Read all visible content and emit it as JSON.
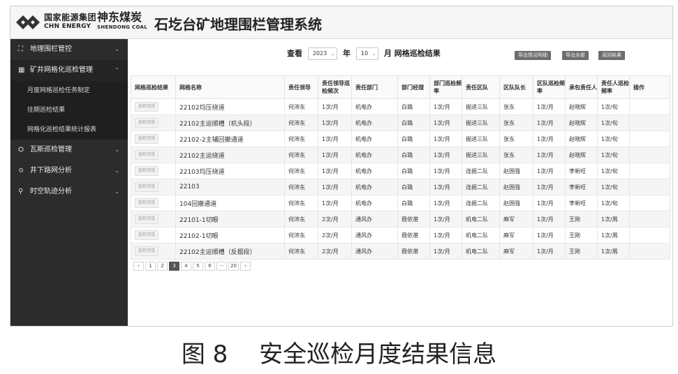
{
  "header": {
    "brand1_cn": "国家能源集团",
    "brand1_en": "CHN ENERGY",
    "brand2_cn": "神东煤炭",
    "brand2_en": "SHENDONG COAL",
    "system_title": "石圪台矿地理围栏管理系统",
    "logo_icon": "chn-energy-logo-icon"
  },
  "sidebar": {
    "items": [
      {
        "label": "地理围栏管控",
        "icon": "geofence-icon",
        "glyph": "⛶",
        "chevron": "⌄"
      },
      {
        "label": "矿井网格化巡检管理",
        "icon": "grid-icon",
        "glyph": "▦",
        "chevron": "⌃"
      },
      {
        "label": "瓦斯巡检管理",
        "icon": "gas-icon",
        "glyph": "⛭",
        "chevron": "⌄"
      },
      {
        "label": "井下路网分析",
        "icon": "network-icon",
        "glyph": "≎",
        "chevron": "⌄"
      },
      {
        "label": "时空轨迹分析",
        "icon": "location-icon",
        "glyph": "⚲",
        "chevron": "⌄"
      }
    ],
    "subitems": [
      "月度网格巡检任务制定",
      "往期巡检结果",
      "网格化巡检结果统计报表"
    ]
  },
  "toolbar": {
    "view_label": "查看",
    "year_value": "2023",
    "year_suffix": "年",
    "month_value": "10",
    "month_suffix": "月 网格巡检结果",
    "dropdown_arrow": "⌄",
    "btn_export_detail": "导出情况明细",
    "btn_export_all": "导出全部",
    "btn_back": "返回结果"
  },
  "table": {
    "headers": [
      "网格巡检结果",
      "网格名称",
      "责任领导",
      "责任领导巡检频次",
      "责任部门",
      "部门经理",
      "部门巡检频率",
      "责任区队",
      "区队队长",
      "区队巡检频率",
      "承包责任人",
      "责任人巡检频率",
      "操作"
    ],
    "rows": [
      [
        "巡检完成",
        "22102均压绕道",
        "何沛东",
        "1次/月",
        "机电办",
        "白璐",
        "1次/月",
        "掘进三队",
        "张东",
        "1次/月",
        "赵晓辉",
        "1次/旬",
        ""
      ],
      [
        "巡检完成",
        "22102主运顺槽（机头段）",
        "何沛东",
        "1次/月",
        "机电办",
        "白璐",
        "1次/月",
        "掘进三队",
        "张东",
        "1次/月",
        "赵晓辉",
        "1次/旬",
        ""
      ],
      [
        "巡检完成",
        "22102-2主辅回撤通道",
        "何沛东",
        "1次/月",
        "机电办",
        "白璐",
        "1次/月",
        "掘进三队",
        "张东",
        "1次/月",
        "赵晓辉",
        "1次/旬",
        ""
      ],
      [
        "巡检完成",
        "22102主运绕道",
        "何沛东",
        "1次/月",
        "机电办",
        "白璐",
        "1次/月",
        "掘进三队",
        "张东",
        "1次/月",
        "赵晓辉",
        "1次/旬",
        ""
      ],
      [
        "巡检完成",
        "22103均压绕道",
        "何沛东",
        "1次/月",
        "机电办",
        "白璐",
        "1次/月",
        "连掘二队",
        "赵国强",
        "1次/月",
        "李新旺",
        "1次/旬",
        ""
      ],
      [
        "巡检完成",
        "22103",
        "何沛东",
        "1次/月",
        "机电办",
        "白璐",
        "1次/月",
        "连掘二队",
        "赵国强",
        "1次/月",
        "李新旺",
        "1次/旬",
        ""
      ],
      [
        "巡检完成",
        "104回撤通道",
        "何沛东",
        "1次/月",
        "机电办",
        "白璐",
        "1次/月",
        "连掘二队",
        "赵国强",
        "1次/月",
        "李新旺",
        "1次/旬",
        ""
      ],
      [
        "巡检完成",
        "22101-1切眼",
        "何沛东",
        "2次/月",
        "通风办",
        "聂依港",
        "1次/月",
        "机电二队",
        "麻军",
        "1次/月",
        "王刚",
        "1次/周",
        ""
      ],
      [
        "巡检完成",
        "22102-1切眼",
        "何沛东",
        "2次/月",
        "通风办",
        "聂依港",
        "1次/月",
        "机电二队",
        "麻军",
        "1次/月",
        "王刚",
        "1次/周",
        ""
      ],
      [
        "巡检完成",
        "22102主运顺槽（反掘段）",
        "何沛东",
        "2次/月",
        "通风办",
        "聂依港",
        "1次/月",
        "机电二队",
        "麻军",
        "1次/月",
        "王刚",
        "1次/周",
        ""
      ]
    ]
  },
  "pagination": {
    "pages": [
      "‹",
      "1",
      "2",
      "3",
      "4",
      "5",
      "6",
      "···",
      "20",
      "›"
    ],
    "active": "3"
  },
  "caption": "图 8　 安全巡检月度结果信息"
}
